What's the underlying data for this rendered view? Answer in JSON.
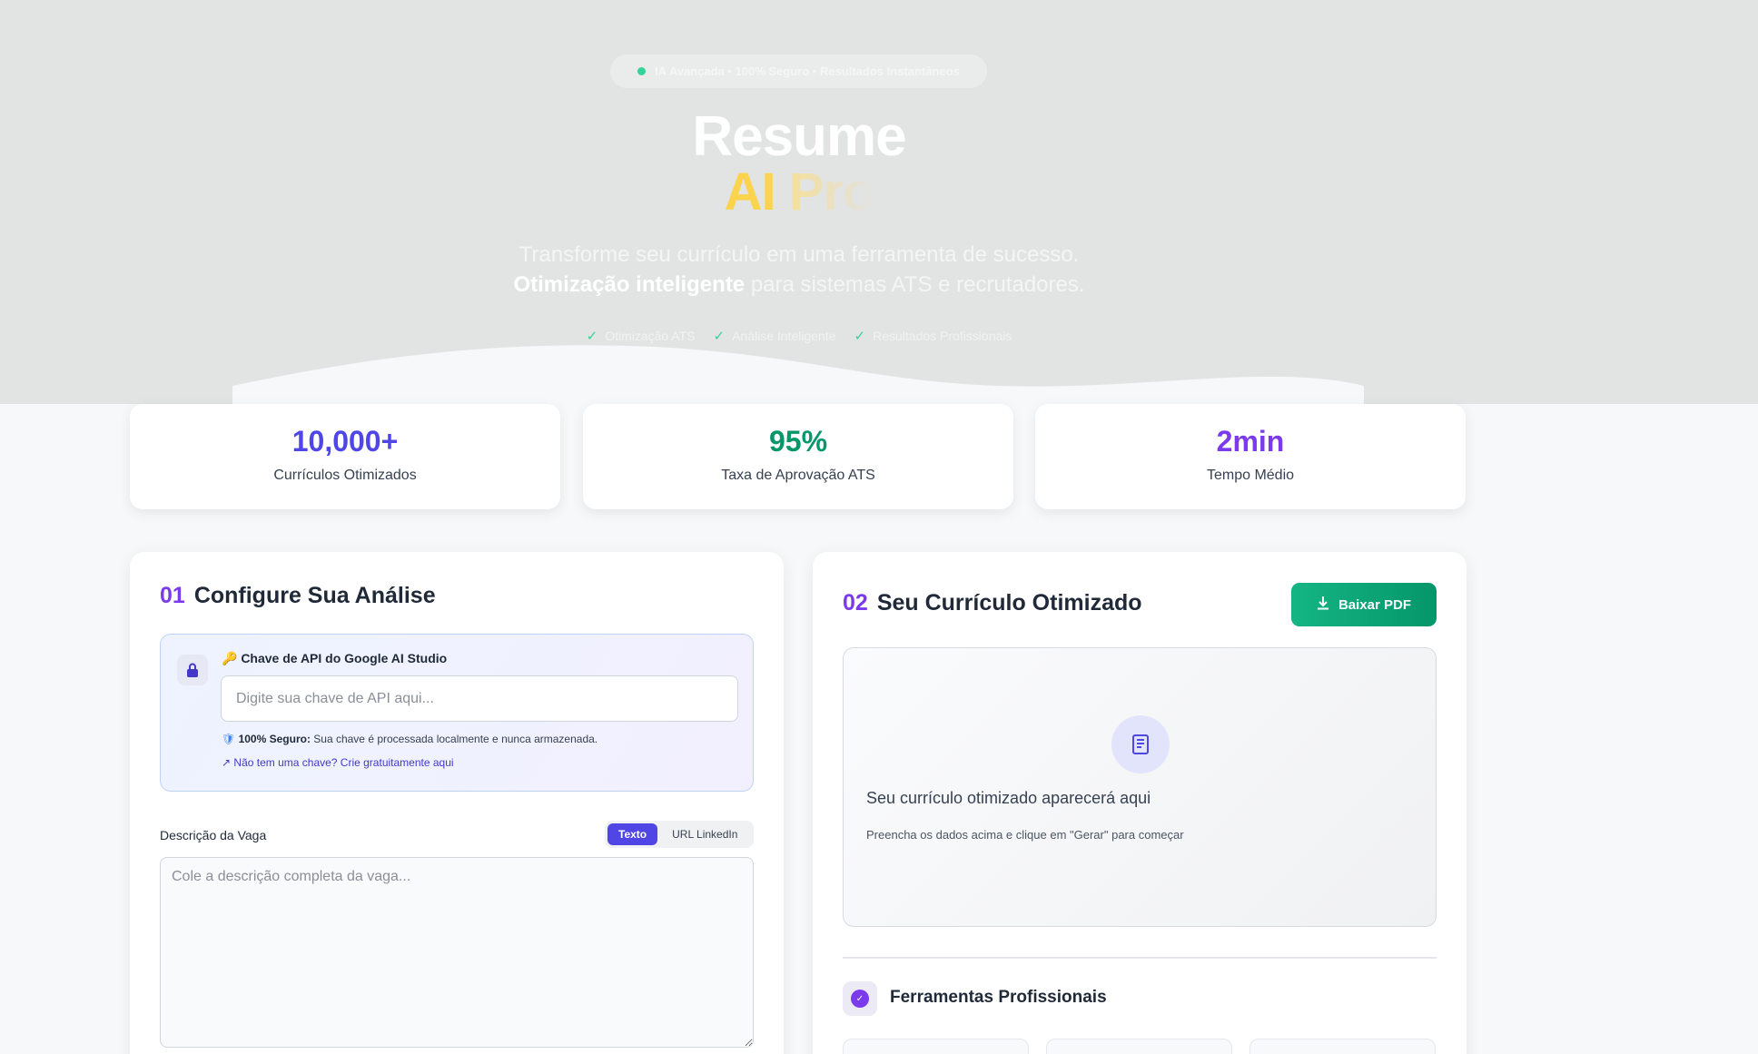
{
  "hero": {
    "badge": "IA Avançada • 100% Seguro • Resultados Instantâneos",
    "title_line1": "Resume",
    "title_ai": "AI",
    "title_pro": "Pro",
    "subtitle_line1": "Transforme seu currículo em uma ferramenta de sucesso.",
    "subtitle_bold": "Otimização inteligente",
    "subtitle_rest": " para sistemas ATS e recrutadores.",
    "features": [
      "Otimização ATS",
      "Análise Inteligente",
      "Resultados Profissionais"
    ]
  },
  "stats": [
    {
      "value": "10,000+",
      "label": "Currículos Otimizados",
      "color": "#4f46e5"
    },
    {
      "value": "95%",
      "label": "Taxa de Aprovação ATS",
      "color": "#059669"
    },
    {
      "value": "2min",
      "label": "Tempo Médio",
      "color": "#7c3aed"
    }
  ],
  "config": {
    "step": "01",
    "title": "Configure Sua Análise",
    "api_label": "🔑 Chave de API do Google AI Studio",
    "api_placeholder": "Digite sua chave de API aqui...",
    "secure_bold": "100% Seguro:",
    "secure_text": " Sua chave é processada localmente e nunca armazenada.",
    "get_key": "Não tem uma chave? Crie gratuitamente aqui",
    "desc_label": "Descrição da Vaga",
    "toggle_text": "Texto",
    "toggle_url": "URL LinkedIn",
    "desc_placeholder": "Cole a descrição completa da vaga..."
  },
  "output": {
    "step": "02",
    "title": "Seu Currículo Otimizado",
    "download": "Baixar PDF",
    "preview_title": "Seu currículo otimizado aparecerá aqui",
    "preview_sub": "Preencha os dados acima e clique em \"Gerar\" para começar",
    "tools_title": "Ferramentas Profissionais"
  }
}
